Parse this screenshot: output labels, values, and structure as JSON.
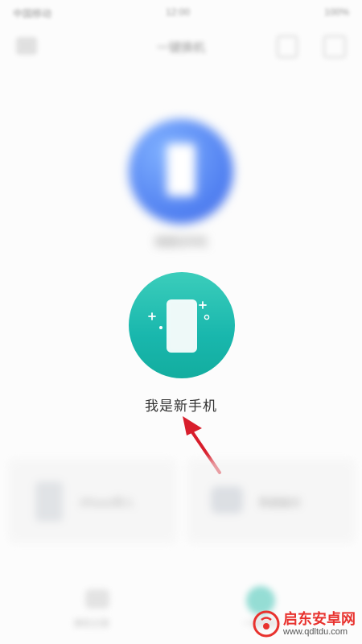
{
  "status_bar": {
    "left": "中国移动",
    "center": "12:00",
    "right": "100%"
  },
  "header": {
    "title": "一键换机"
  },
  "options": {
    "old_phone_label": "我是旧手机",
    "new_phone_label": "我是新手机"
  },
  "cards": {
    "left_label": "iPhone导入",
    "right_label": "数据备份"
  },
  "tabs": {
    "first_label": "换机记录",
    "second_label": "一键换机"
  },
  "watermark": {
    "brand": "启东安卓网",
    "url": "www.qdltdu.com"
  },
  "colors": {
    "new_phone_circle": "#19b7ad",
    "old_phone_circle": "#4f7ef0",
    "arrow": "#d81e2c",
    "watermark_red": "#e8322e"
  }
}
